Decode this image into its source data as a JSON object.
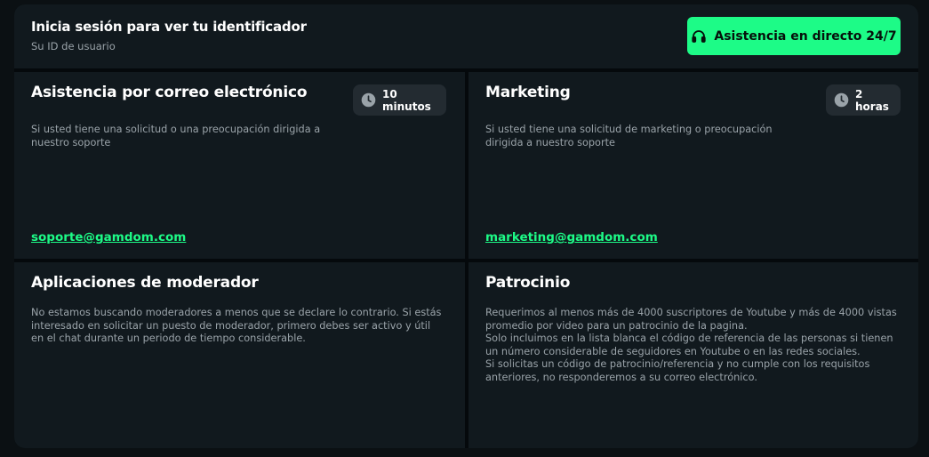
{
  "header": {
    "title": "Inicia sesión para ver tu identificador",
    "subtitle": "Su ID de usuario",
    "live_support_label": "Asistencia en directo 24/7"
  },
  "cards": [
    {
      "title": "Asistencia por correo electrónico",
      "badge": "10 minutos",
      "description": [
        "Si usted tiene una solicitud o una preocupación dirigida a nuestro soporte"
      ],
      "email": "soporte@gamdom.com"
    },
    {
      "title": "Marketing",
      "badge": "2 horas",
      "description": [
        "Si usted tiene una solicitud de marketing o preocupación dirigida a nuestro soporte"
      ],
      "email": "marketing@gamdom.com"
    },
    {
      "title": "Aplicaciones de moderador",
      "description": [
        "No estamos buscando moderadores a menos que se declare lo contrario. Si estás interesado en solicitar un puesto de moderador, primero debes ser activo y útil en el chat durante un periodo de tiempo considerable."
      ]
    },
    {
      "title": "Patrocinio",
      "description": [
        "Requerimos al menos más de 4000 suscriptores de Youtube y más de 4000 vistas promedio por video para un patrocinio de la pagina.",
        "Solo incluimos en la lista blanca el código de referencia de las personas si tienen un número considerable de seguidores en Youtube o en las redes sociales.",
        "Si solicitas un código de patrocinio/referencia y no cumple con los requisitos anteriores, no responderemos a su correo electrónico."
      ]
    }
  ],
  "colors": {
    "accent": "#1dfb87",
    "card_bg": "#11191e",
    "page_bg": "#05090c"
  },
  "icons": {
    "live_support": "headset-icon",
    "badge": "clock-icon"
  }
}
